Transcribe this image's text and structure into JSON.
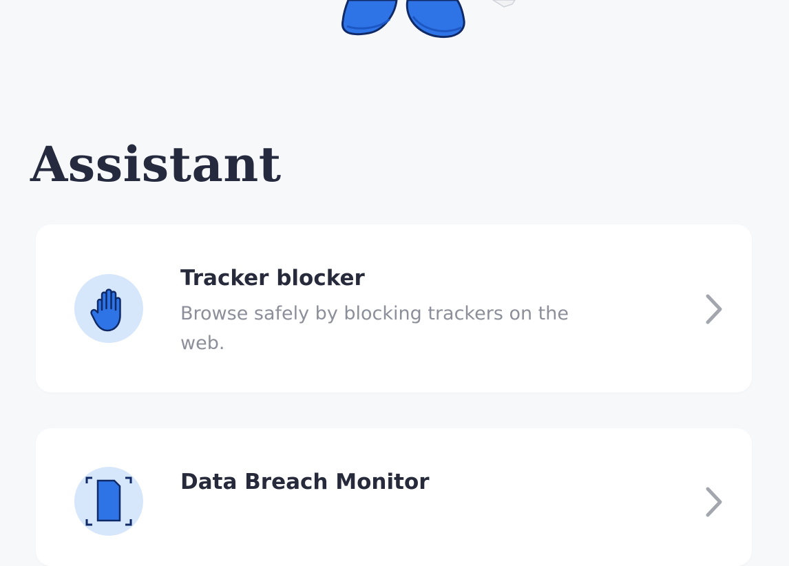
{
  "page": {
    "title": "Assistant"
  },
  "colors": {
    "background": "#f7f8fa",
    "card": "#ffffff",
    "accent_blue": "#2f74e6",
    "icon_circle": "#d6e6fb",
    "title_text": "#252a3e",
    "description_text": "#8c8f99",
    "chevron": "#a3a6ad"
  },
  "illustration": {
    "icon": "mascot-feet-illustration"
  },
  "cards": [
    {
      "title": "Tracker blocker",
      "description": "Browse safely by blocking trackers on the web.",
      "icon": "hand-stop-icon"
    },
    {
      "title": "Data Breach Monitor",
      "description": "",
      "icon": "document-scan-icon"
    }
  ]
}
